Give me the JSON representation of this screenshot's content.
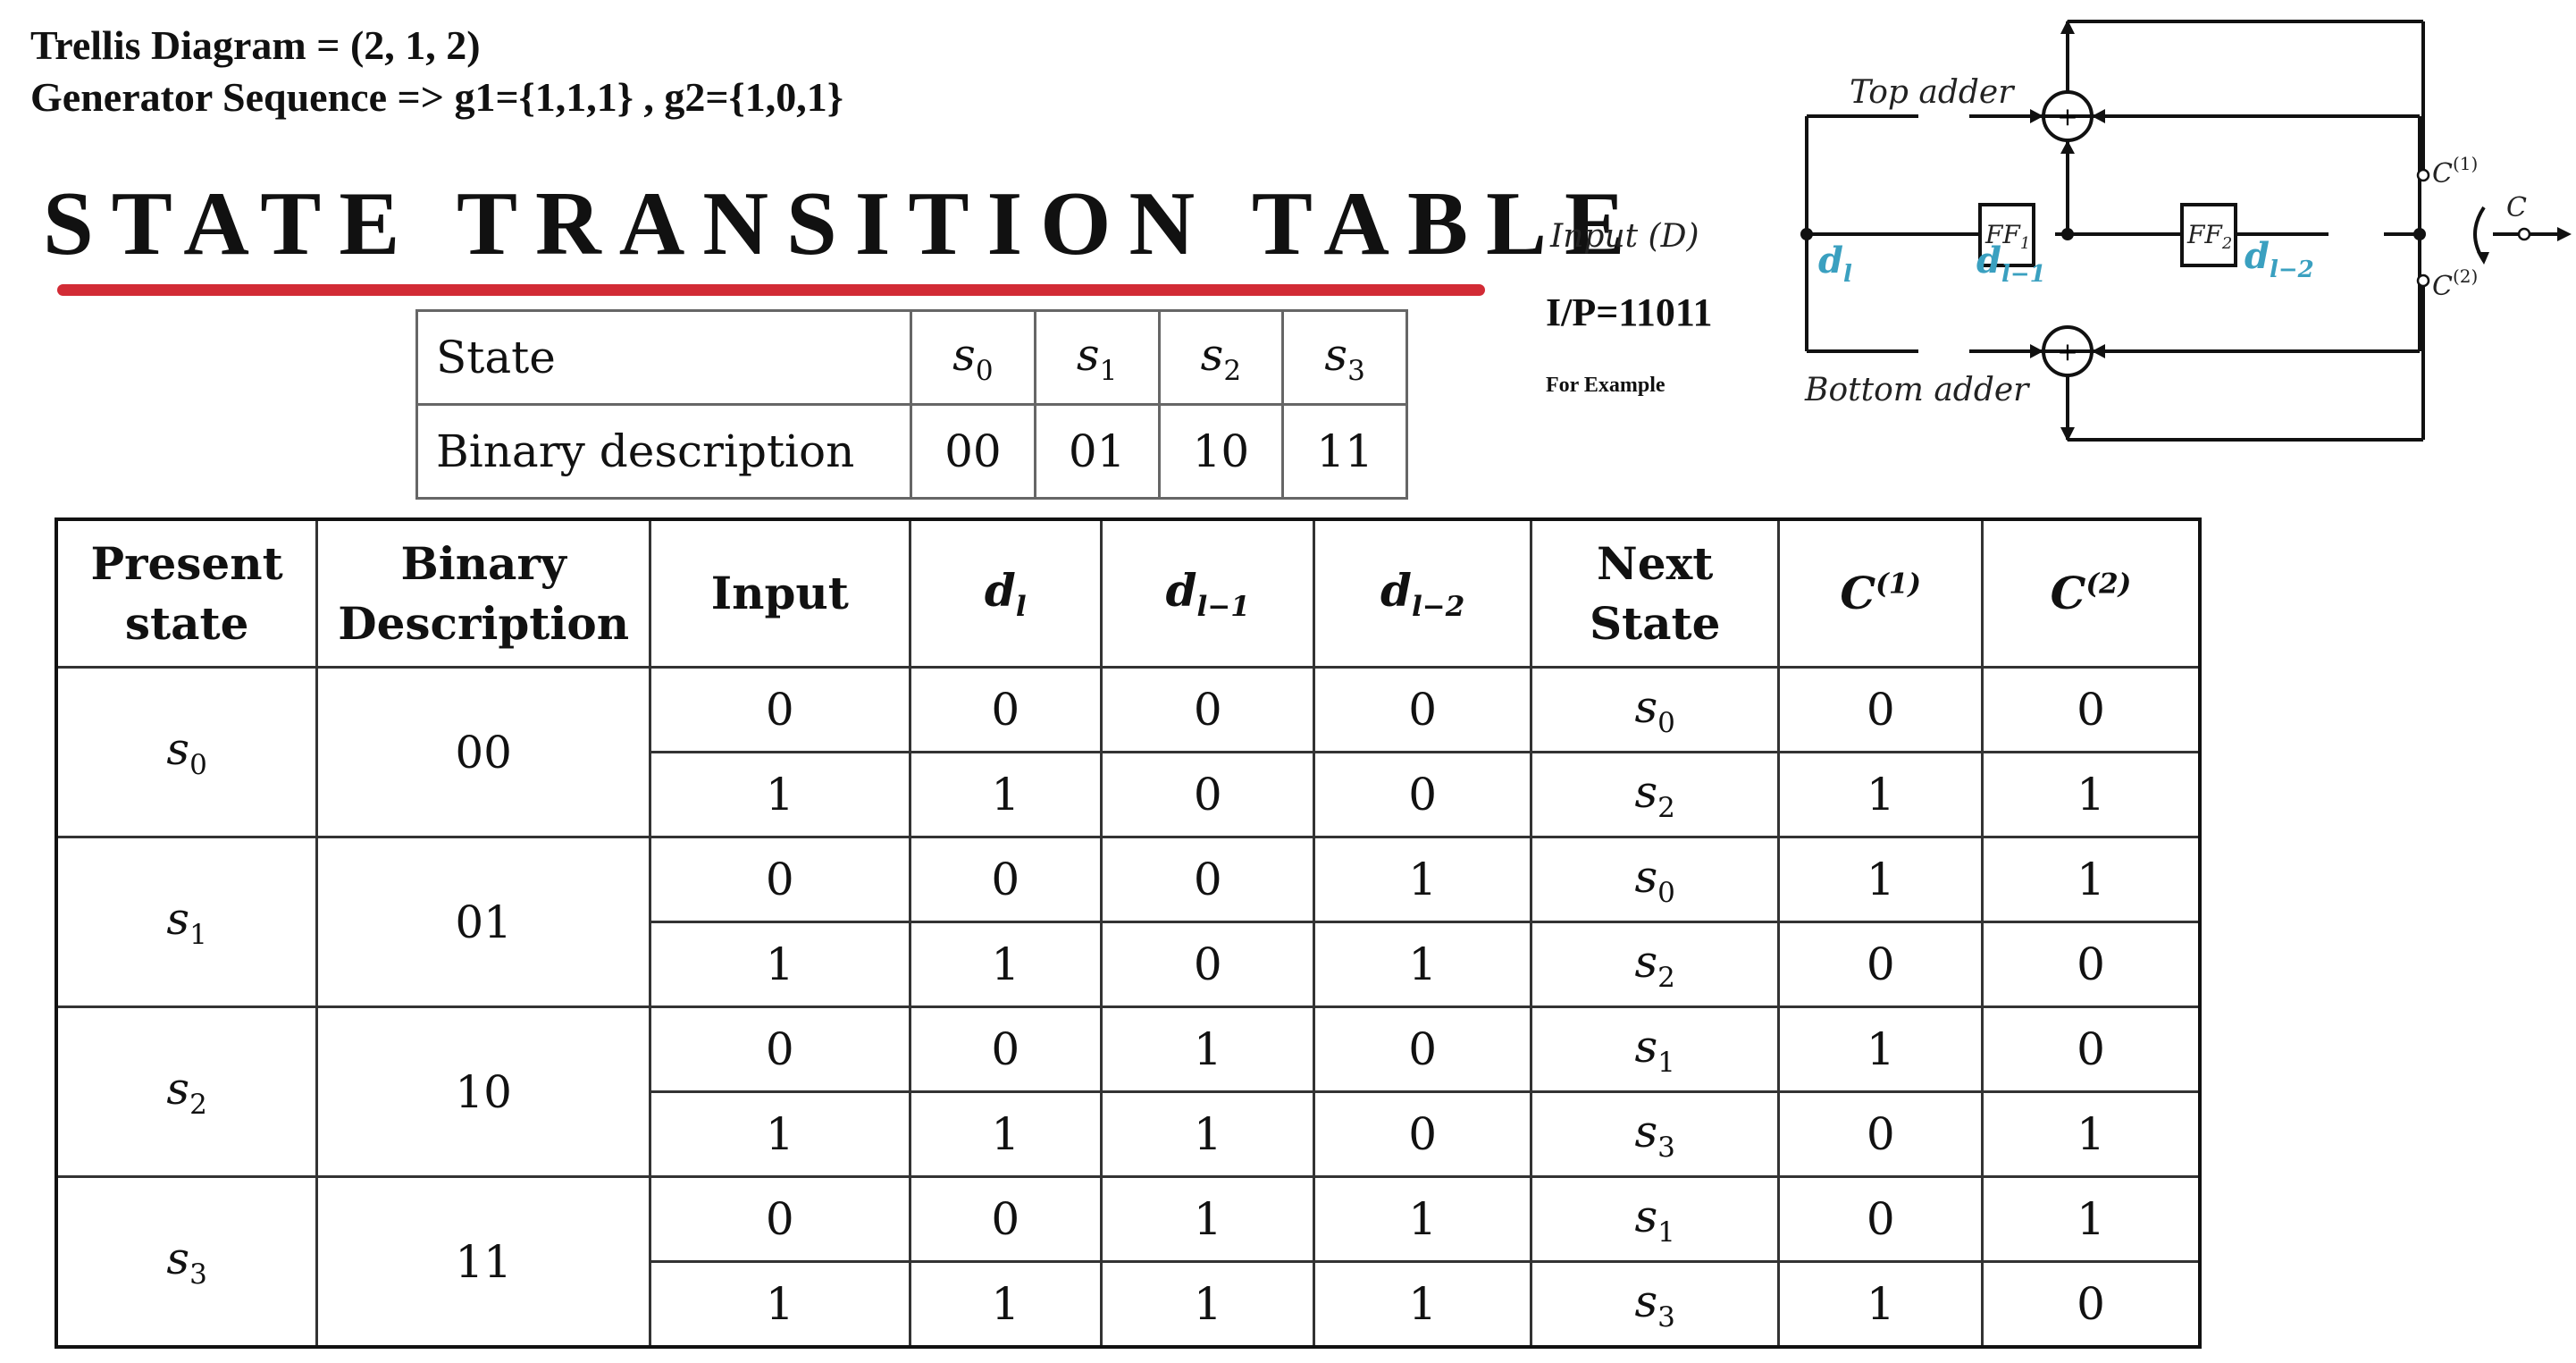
{
  "header": {
    "line1": "Trellis Diagram = (2, 1, 2)",
    "line2": "Generator Sequence => g1={1,1,1} , g2={1,0,1}"
  },
  "title": "STATE TRANSITION TABLE",
  "colors": {
    "underline": "#d22b35",
    "signal_label": "#3aa0c0",
    "line": "#111111"
  },
  "state_table": {
    "row_label_state": "State",
    "row_label_binary": "Binary description",
    "states": [
      {
        "sym": "s",
        "sub": "0",
        "binary": "00"
      },
      {
        "sym": "s",
        "sub": "1",
        "binary": "01"
      },
      {
        "sym": "s",
        "sub": "2",
        "binary": "10"
      },
      {
        "sym": "s",
        "sub": "3",
        "binary": "11"
      }
    ]
  },
  "diagram": {
    "input_label": "Input (D)",
    "top_adder": "Top adder",
    "bottom_adder": "Bottom adder",
    "ff1": "FF",
    "ff1_sub": "1",
    "ff2": "FF",
    "ff2_sub": "2",
    "dl": "d",
    "dl_sub": "l",
    "dl1_sub": "l−1",
    "dl2_sub": "l−2",
    "c1": "C",
    "c1_sup": "(1)",
    "c2": "C",
    "c2_sup": "(2)",
    "c_out": "C",
    "plus": "+",
    "ip_text": "I/P=11011",
    "for_example": "For Example"
  },
  "main_table": {
    "headers": {
      "present_state_1": "Present",
      "present_state_2": "state",
      "binary_1": "Binary",
      "binary_2": "Description",
      "input": "Input",
      "dl": "d",
      "dl_sub": "l",
      "dl1": "d",
      "dl1_sub": "l−1",
      "dl2": "d",
      "dl2_sub": "l−2",
      "next_1": "Next",
      "next_2": "State",
      "c1": "C",
      "c1_sup": "(1)",
      "c2": "C",
      "c2_sup": "(2)"
    },
    "groups": [
      {
        "state": "s",
        "state_sub": "0",
        "binary": "00",
        "rows": [
          {
            "input": "0",
            "dl": "0",
            "dl1": "0",
            "dl2": "0",
            "next": "s",
            "next_sub": "0",
            "c1": "0",
            "c2": "0"
          },
          {
            "input": "1",
            "dl": "1",
            "dl1": "0",
            "dl2": "0",
            "next": "s",
            "next_sub": "2",
            "c1": "1",
            "c2": "1"
          }
        ]
      },
      {
        "state": "s",
        "state_sub": "1",
        "binary": "01",
        "rows": [
          {
            "input": "0",
            "dl": "0",
            "dl1": "0",
            "dl2": "1",
            "next": "s",
            "next_sub": "0",
            "c1": "1",
            "c2": "1"
          },
          {
            "input": "1",
            "dl": "1",
            "dl1": "0",
            "dl2": "1",
            "next": "s",
            "next_sub": "2",
            "c1": "0",
            "c2": "0"
          }
        ]
      },
      {
        "state": "s",
        "state_sub": "2",
        "binary": "10",
        "rows": [
          {
            "input": "0",
            "dl": "0",
            "dl1": "1",
            "dl2": "0",
            "next": "s",
            "next_sub": "1",
            "c1": "1",
            "c2": "0"
          },
          {
            "input": "1",
            "dl": "1",
            "dl1": "1",
            "dl2": "0",
            "next": "s",
            "next_sub": "3",
            "c1": "0",
            "c2": "1"
          }
        ]
      },
      {
        "state": "s",
        "state_sub": "3",
        "binary": "11",
        "rows": [
          {
            "input": "0",
            "dl": "0",
            "dl1": "1",
            "dl2": "1",
            "next": "s",
            "next_sub": "1",
            "c1": "0",
            "c2": "1"
          },
          {
            "input": "1",
            "dl": "1",
            "dl1": "1",
            "dl2": "1",
            "next": "s",
            "next_sub": "3",
            "c1": "1",
            "c2": "0"
          }
        ]
      }
    ]
  }
}
